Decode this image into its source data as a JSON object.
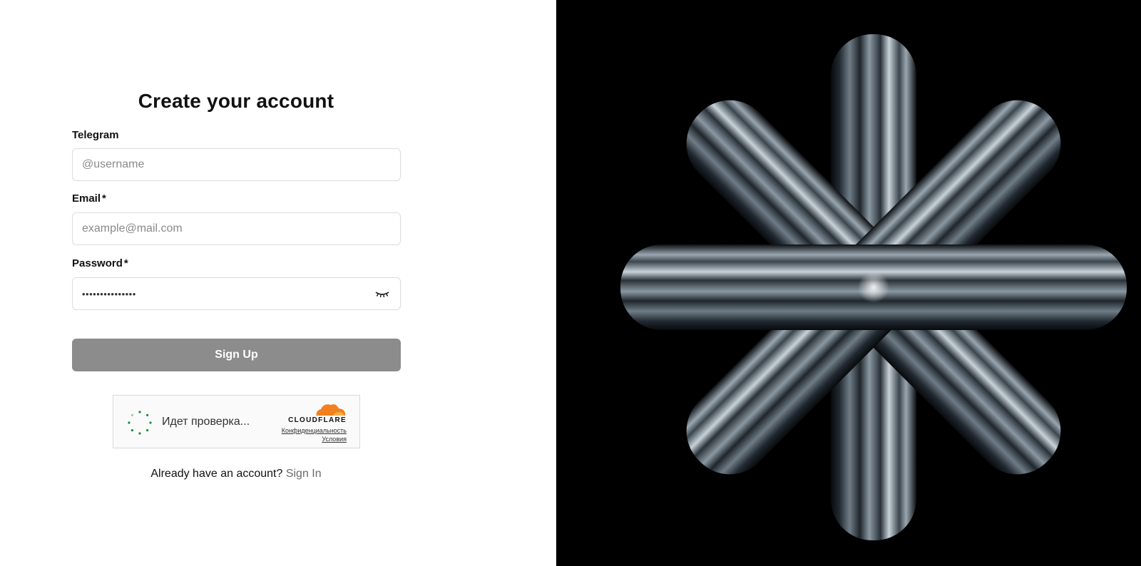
{
  "form": {
    "title": "Create your account",
    "telegram": {
      "label": "Telegram",
      "placeholder": "@username",
      "value": ""
    },
    "email": {
      "label": "Email",
      "required_mark": "*",
      "placeholder": "example@mail.com",
      "value": ""
    },
    "password": {
      "label": "Password",
      "required_mark": "*",
      "masked_value": "•••••••••••••••",
      "toggle_icon": "eye-closed-icon"
    },
    "submit_label": "Sign Up",
    "submit_color": "#8c8c8c"
  },
  "captcha": {
    "status_text": "Идет проверка...",
    "brand": "CLOUDFLARE",
    "privacy_link": "Конфиденциальность",
    "terms_link": "Условия",
    "brand_color": "#f38020",
    "spinner_color": "#1b8a3a"
  },
  "footer": {
    "prompt": "Already have an account?",
    "signin_label": "Sign In"
  },
  "hero": {
    "background": "#000000",
    "icon": "metallic-asterisk-art"
  }
}
